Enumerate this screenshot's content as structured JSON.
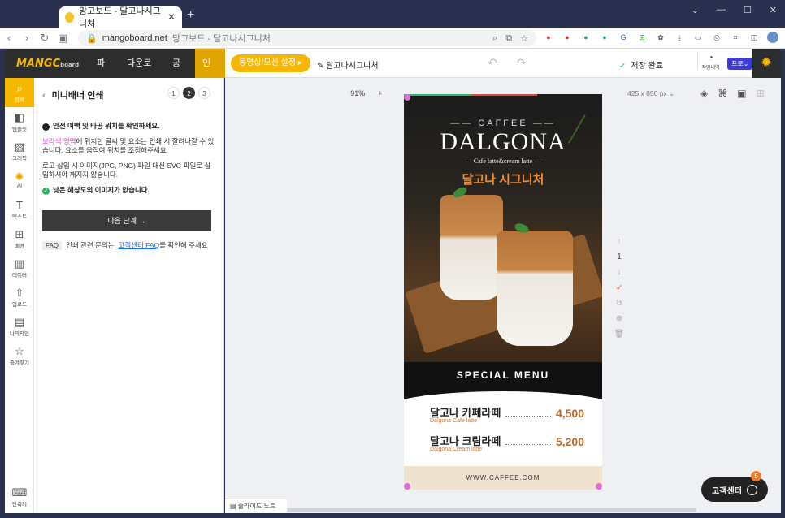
{
  "browser": {
    "tab_title": "망고보드 - 달고나시그니처",
    "url_domain": "mangoboard.net",
    "url_title": "망고보드 - 달고나시그니처"
  },
  "app": {
    "logo_text": "MANGC",
    "logo_sub": "board",
    "menus": [
      "파일",
      "다운로드",
      "공유",
      "인쇄"
    ],
    "anim_button": "동영상/모션 설정 ▸",
    "doc_name": "달고나시그니처",
    "saved": "저장 완료",
    "work_history": "작업내역",
    "pro": "프로",
    "accent": "#f5b700"
  },
  "left_nav": {
    "items": [
      "검색",
      "템플릿",
      "그래픽",
      "AI",
      "텍스트",
      "배경",
      "데이터",
      "업로드",
      "나의작업",
      "즐겨찾기"
    ],
    "bottom": "단축키"
  },
  "panel": {
    "title": "미니배너 인쇄",
    "steps": [
      "1",
      "2",
      "3"
    ],
    "notice_title": "안전 여백 및 타공 위치를 확인하세요.",
    "notice_pink": "보라색 영역",
    "notice_rest": "에 위치한 글씨 및 요소는 인쇄 시 잘려나갈 수 있습니다. 요소를 움직여 위치를 조정해주세요.",
    "logo_note": "로고 삽입 시 이미지(JPG, PNG) 파일 대신 SVG 파일로 삽입하셔야 깨지지 않습니다.",
    "ok_note": "낮은 해상도의 이미지가 없습니다.",
    "next_button": "다음 단계 →",
    "faq_tag": "FAQ",
    "faq_pre": "인쇄 관련 문의는",
    "faq_link": "고객센터 FAQ",
    "faq_post": "를 확인해 주세요"
  },
  "canvas": {
    "zoom_minus": "−",
    "zoom": "91%",
    "zoom_plus": "+",
    "size": "425 x 850 px",
    "page": "1"
  },
  "poster": {
    "brand": "CAFFEE",
    "title": "DALGONA",
    "subtitle": "— Cafe latte&cream latte —",
    "korean": "달고나 시그니처",
    "special": "SPECIAL MENU",
    "items": [
      {
        "name": "달고나 카페라떼",
        "en": "Dalgona Cafe latte",
        "price": "4,500"
      },
      {
        "name": "달고나 크림라떼",
        "en": "Dalgona Cream latte",
        "price": "5,200"
      }
    ],
    "footer": "WWW.CAFFEE.COM"
  },
  "bottom": {
    "slide_note": "슬라이드 노트",
    "support": "고객센터",
    "support_badge": "5"
  }
}
